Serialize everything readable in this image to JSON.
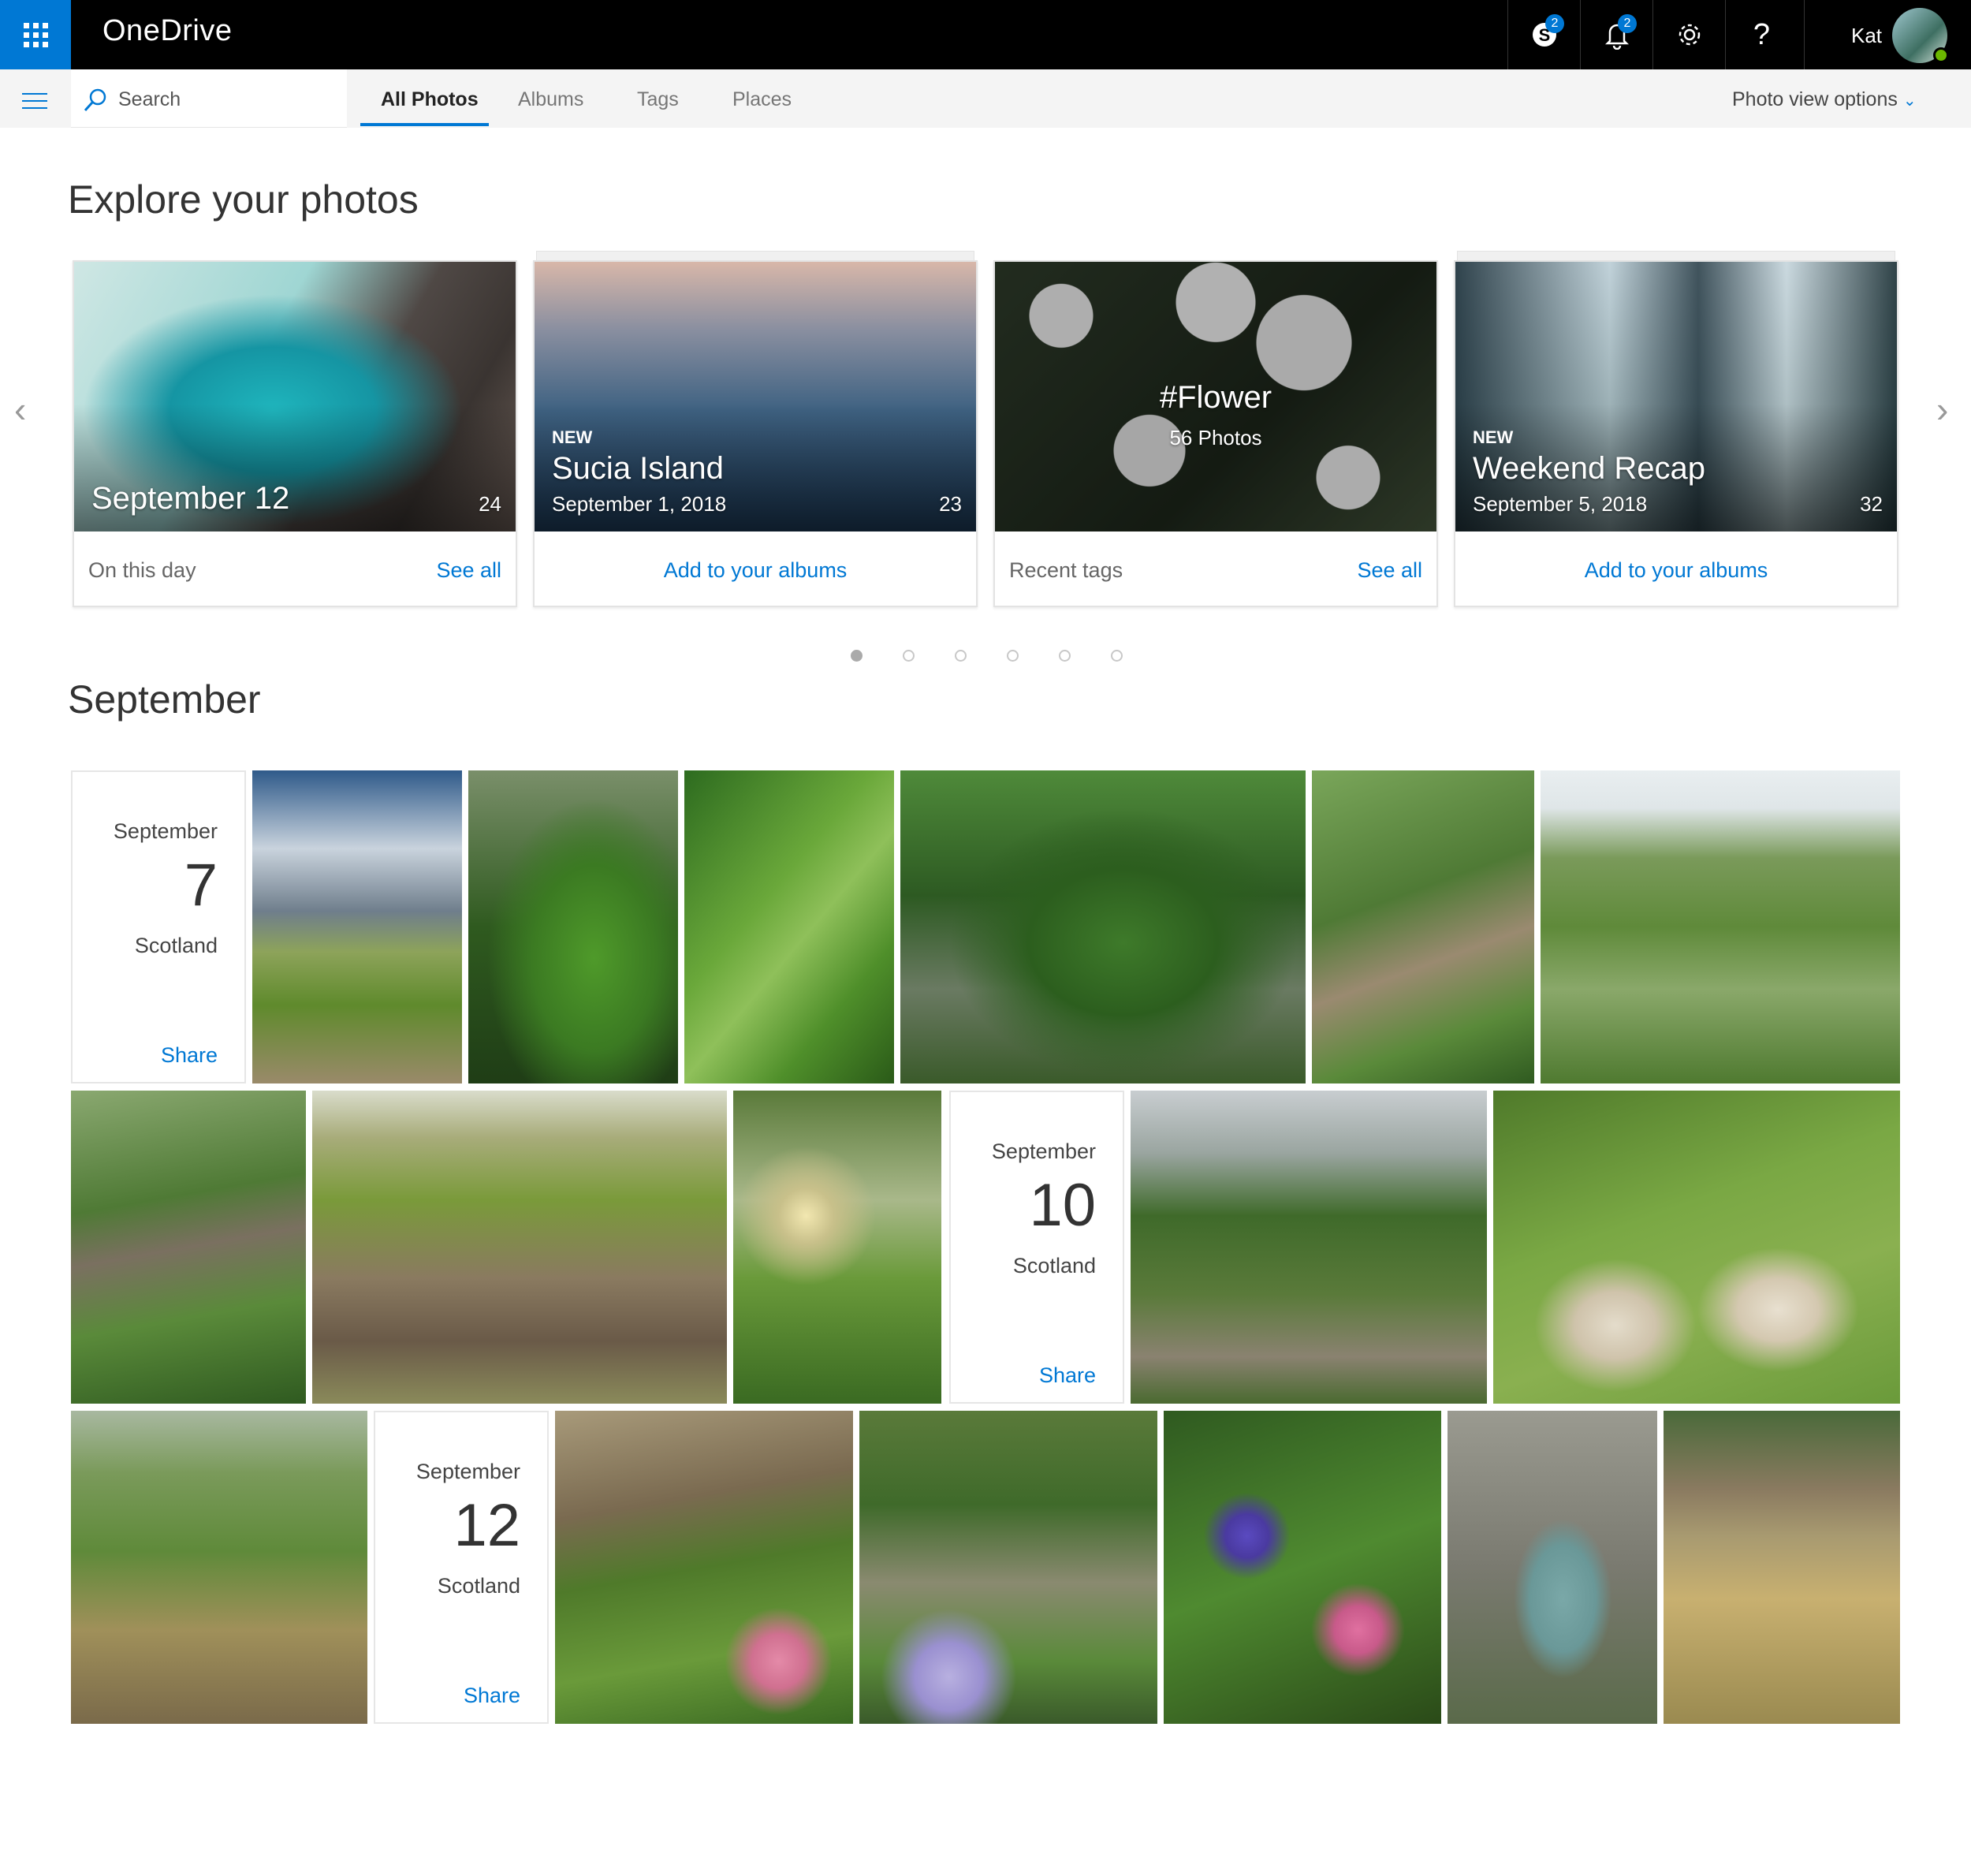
{
  "app": {
    "title": "OneDrive"
  },
  "topbar": {
    "skype_badge": "2",
    "notifications_badge": "2",
    "help_label": "?",
    "user_name": "Kat",
    "icons": [
      "waffle-icon",
      "skype-icon",
      "bell-icon",
      "gear-icon",
      "help-icon"
    ]
  },
  "nav": {
    "search_placeholder": "Search",
    "tabs": [
      {
        "label": "All Photos",
        "active": true
      },
      {
        "label": "Albums",
        "active": false
      },
      {
        "label": "Tags",
        "active": false
      },
      {
        "label": "Places",
        "active": false
      }
    ],
    "view_options": "Photo view options"
  },
  "explore": {
    "heading": "Explore your photos",
    "cards": [
      {
        "title": "September 12",
        "count": "24",
        "footer_left": "On this day",
        "footer_right": "See all"
      },
      {
        "tag": "NEW",
        "title": "Sucia Island",
        "date": "September 1, 2018",
        "count": "23",
        "footer_action": "Add to your albums"
      },
      {
        "title": "#Flower",
        "subtitle": "56 Photos",
        "footer_left": "Recent tags",
        "footer_right": "See all"
      },
      {
        "tag": "NEW",
        "title": "Weekend Recap",
        "date": "September 5, 2018",
        "count": "32",
        "footer_action": "Add to your albums"
      }
    ],
    "pager": {
      "pages": 6,
      "current": 1
    }
  },
  "month": {
    "heading": "September",
    "days": [
      {
        "month": "September",
        "day": "7",
        "place": "Scotland",
        "action": "Share"
      },
      {
        "month": "September",
        "day": "10",
        "place": "Scotland",
        "action": "Share"
      },
      {
        "month": "September",
        "day": "12",
        "place": "Scotland",
        "action": "Share"
      }
    ]
  },
  "colors": {
    "accent": "#0078d4",
    "topbar": "#000000",
    "nav": "#f4f4f4"
  }
}
